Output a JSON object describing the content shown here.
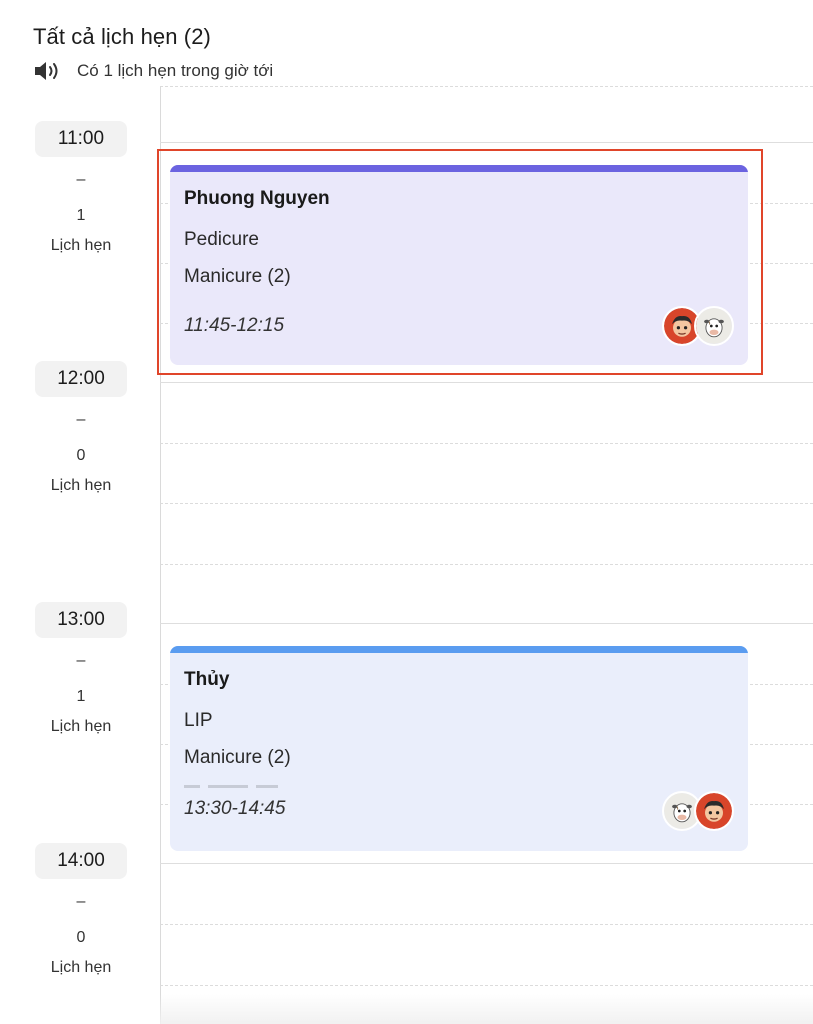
{
  "header": {
    "title": "Tất cả lịch hẹn (2)",
    "subtitle": "Có 1 lịch hẹn trong giờ tới"
  },
  "timeslots": [
    {
      "time": "11:00",
      "dash": "–",
      "count": "1",
      "unit": "Lịch hẹn"
    },
    {
      "time": "12:00",
      "dash": "–",
      "count": "0",
      "unit": "Lịch hẹn"
    },
    {
      "time": "13:00",
      "dash": "–",
      "count": "1",
      "unit": "Lịch hẹn"
    },
    {
      "time": "14:00",
      "dash": "–",
      "count": "0",
      "unit": "Lịch hẹn"
    }
  ],
  "appointments": [
    {
      "customer": "Phuong Nguyen",
      "services": [
        "Pedicure",
        "Manicure (2)"
      ],
      "time": "11:45-12:15",
      "accent_color": "#6b63e0",
      "background": "#eae8fa",
      "avatars": [
        "boy-avatar-icon",
        "cow-avatar-icon"
      ],
      "highlighted": true
    },
    {
      "customer": "Thủy",
      "services": [
        "LIP",
        "Manicure (2)"
      ],
      "time": "13:30-14:45",
      "accent_color": "#5a9cf0",
      "background": "#eaeefb",
      "avatars": [
        "cow-avatar-icon",
        "boy-avatar-icon"
      ],
      "highlighted": false
    }
  ],
  "colors": {
    "highlight_border": "#e0452a",
    "time_pill_bg": "#f2f2f2"
  }
}
